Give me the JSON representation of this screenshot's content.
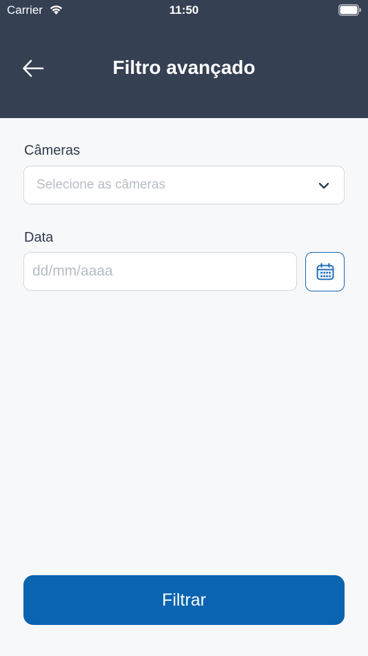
{
  "status_bar": {
    "carrier": "Carrier",
    "time": "11:50",
    "icons": [
      "wifi-icon",
      "battery-icon"
    ]
  },
  "header": {
    "title": "Filtro avançado",
    "back_icon": "arrow-left-icon"
  },
  "form": {
    "cameras": {
      "label": "Câmeras",
      "placeholder": "Selecione as câmeras",
      "icon": "chevron-down-icon"
    },
    "date": {
      "label": "Data",
      "placeholder": "dd/mm/aaaa",
      "value": "",
      "calendar_icon": "calendar-icon"
    }
  },
  "actions": {
    "filter_label": "Filtrar"
  },
  "colors": {
    "header_bg": "#354052",
    "page_bg": "#f7f8fa",
    "primary": "#0a64b0",
    "border": "#d3d7dd",
    "placeholder": "#b7bcc4",
    "text": "#2e3a4b"
  }
}
